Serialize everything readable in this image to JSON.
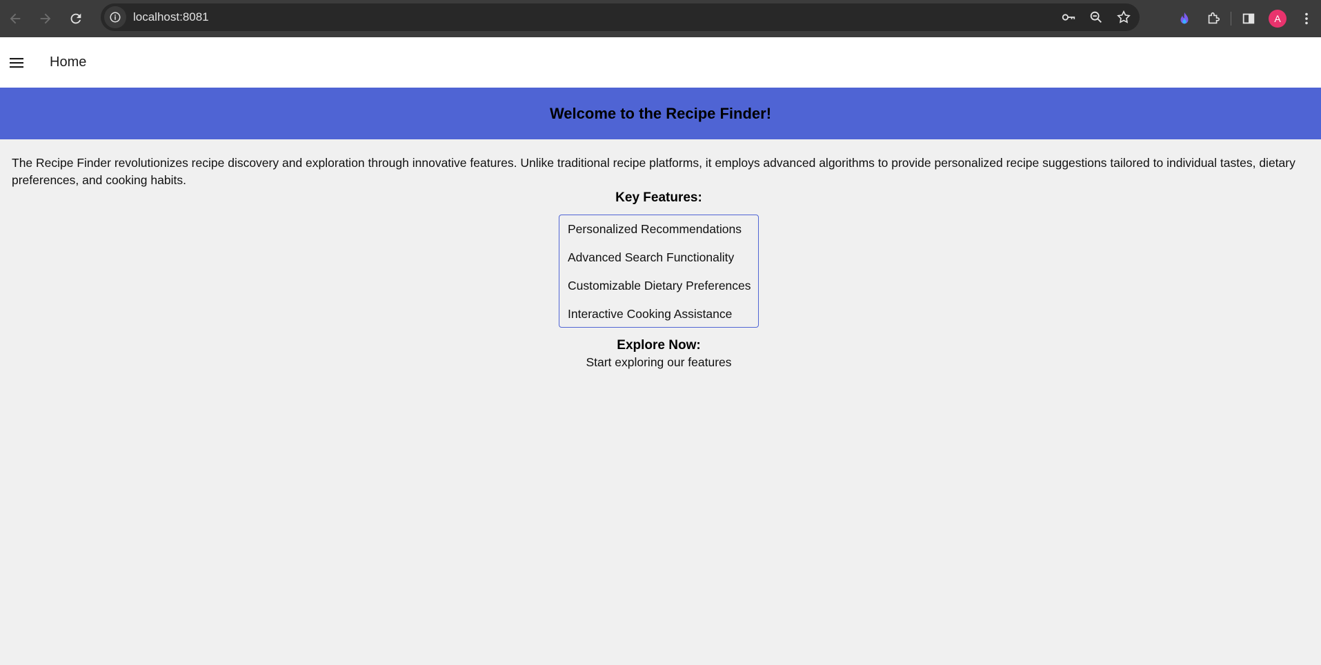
{
  "browser": {
    "url": "localhost:8081",
    "avatar_letter": "A",
    "icons": [
      "back-icon",
      "forward-icon",
      "reload-icon",
      "site-info-icon",
      "password-key-icon",
      "zoom-icon",
      "bookmark-star-icon",
      "extension-flame-icon",
      "extensions-puzzle-icon",
      "side-panel-icon",
      "profile-avatar",
      "more-menu-icon"
    ]
  },
  "appbar": {
    "title": "Home",
    "menu_icon": "hamburger-menu-icon"
  },
  "banner": {
    "title": "Welcome to the Recipe Finder!",
    "color": "#4f64d4"
  },
  "main": {
    "intro": "The Recipe Finder revolutionizes recipe discovery and exploration through innovative features. Unlike traditional recipe platforms, it employs advanced algorithms to provide personalized recipe suggestions tailored to individual tastes, dietary preferences, and cooking habits.",
    "key_features_title": "Key Features:",
    "features": [
      "Personalized Recommendations",
      "Advanced Search Functionality",
      "Customizable Dietary Preferences",
      "Interactive Cooking Assistance"
    ],
    "explore_title": "Explore Now:",
    "explore_subtitle": "Start exploring our features"
  }
}
